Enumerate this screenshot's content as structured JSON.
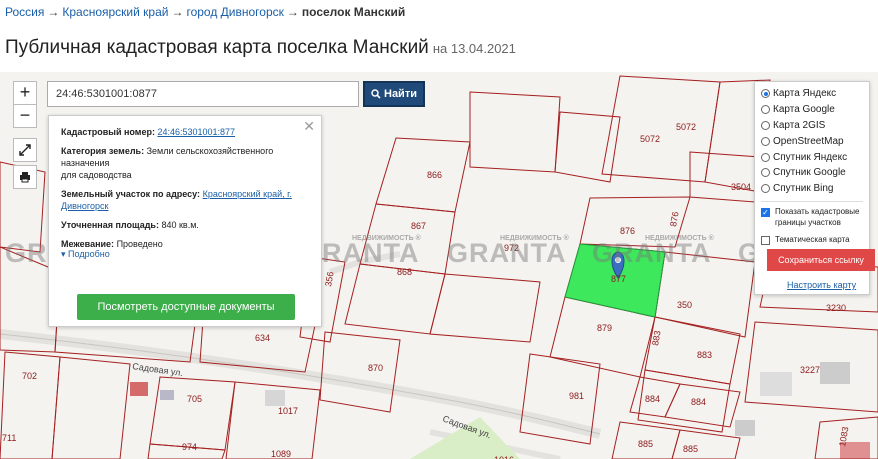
{
  "breadcrumbs": {
    "items": [
      "Россия",
      "Красноярский край",
      "город Дивногорск"
    ],
    "current": "поселок Манский",
    "separator": "→"
  },
  "page": {
    "title": "Публичная кадастровая карта поселка Манский",
    "date": "на 13.04.2021"
  },
  "search": {
    "value": "24:46:5301001:0877",
    "button_label": "Найти"
  },
  "map_controls": {
    "zoom_in": "+",
    "zoom_out": "−"
  },
  "popup": {
    "cadastral_number_label": "Кадастровый номер:",
    "cadastral_number_value": "24:46:5301001:877",
    "category_label": "Категория земель:",
    "category_value_line1": "Земли сельскохозяйственного назначения",
    "category_value_line2": "для садоводства",
    "address_label": "Земельный участок по адресу:",
    "address_value": "Красноярский край, г. Дивногорск",
    "area_label": "Уточненная площадь:",
    "area_value": "840 кв.м.",
    "survey_label": "Межевание:",
    "survey_value": "Проведено",
    "more_label": "Подробно",
    "documents_button": "Посмотреть доступные документы"
  },
  "layers": {
    "options": [
      "Карта Яндекс",
      "Карта Google",
      "Карта 2GIS",
      "OpenStreetMap",
      "Спутник Яндекс",
      "Спутник Google",
      "Спутник Bing"
    ],
    "selected": "Карта Яндекс",
    "show_borders_label": "Показать кадастровые границы участков",
    "show_borders_checked": true,
    "thematic_label": "Тематическая карта",
    "thematic_checked": false,
    "save_label": "Сохраниться ссылку",
    "fix_map_label": "Настроить карту"
  },
  "watermark": {
    "text": "GRANTA",
    "caption": "НЕДВИЖИМОСТЬ ®"
  },
  "map_labels": {
    "plots": [
      "5072",
      "5072",
      "3504",
      "866",
      "867",
      "868",
      "876",
      "350",
      "879",
      "883",
      "883",
      "634",
      "870",
      "972",
      "981",
      "884",
      "884",
      "885",
      "885",
      "705",
      "1017",
      "974",
      "1089",
      "1016",
      "702",
      "711",
      "3227",
      "3230",
      "1083",
      "356",
      "877"
    ],
    "streets": [
      "Садовая ул.",
      "Садовая ул."
    ]
  },
  "colors": {
    "accent": "#1f4a7a",
    "selected_plot": "#3de85c",
    "plot_border": "#a52020",
    "green_button": "#3cae4a"
  }
}
